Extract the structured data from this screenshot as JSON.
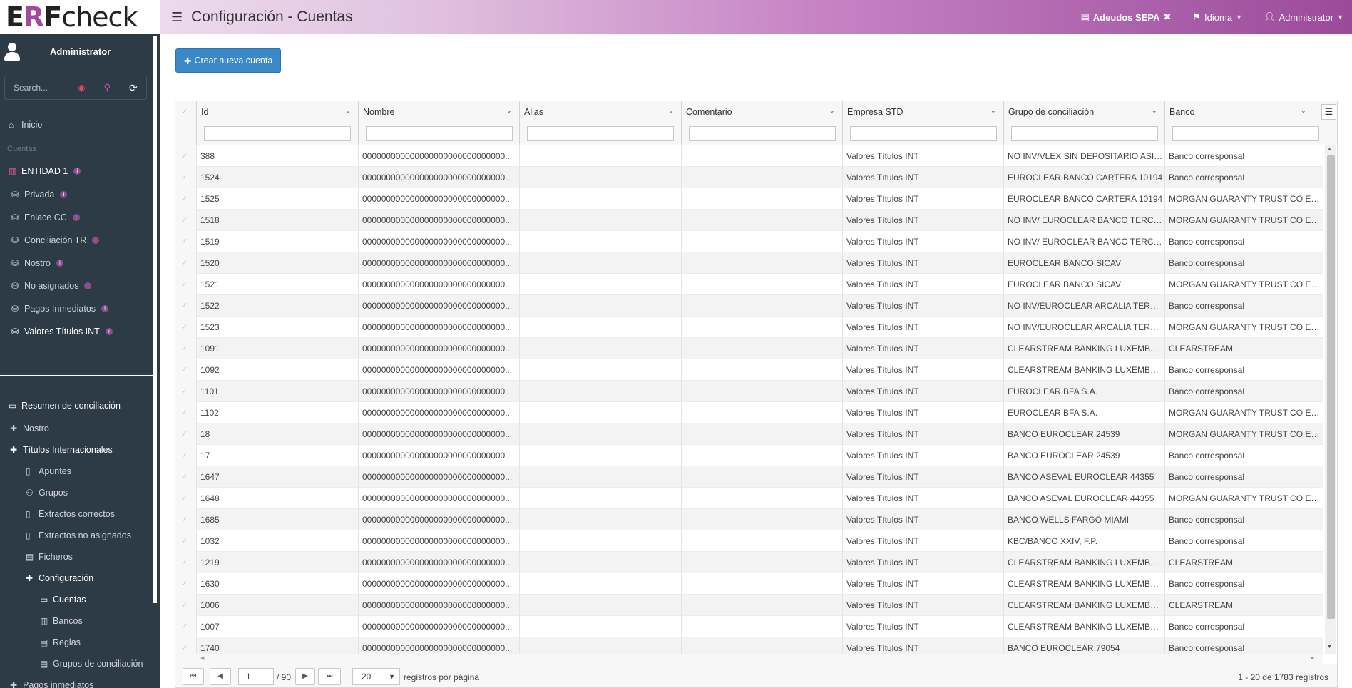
{
  "topbar": {
    "logo_prefix": "E",
    "logo_r": "R",
    "logo_f": "F",
    "logo_suffix": "check",
    "title": "Configuración - Cuentas",
    "sepa": "Adeudos SEPA",
    "idioma": "Idioma",
    "admin": "Administrator"
  },
  "sidebar": {
    "user": "Administrator",
    "search_placeholder": "Search...",
    "inicio": "Inicio",
    "section_cuentas": "Cuentas",
    "entidad": "ENTIDAD 1",
    "entities": [
      "Privada",
      "Enlace CC",
      "Conciliación TR",
      "Nostro",
      "No asignados",
      "Pagos Inmediatos",
      "Valores Títulos INT"
    ],
    "resumen": "Resumen de conciliación",
    "nostro": "Nostro",
    "titulos": "Títulos Internacionales",
    "sub": [
      "Apuntes",
      "Grupos",
      "Extractos correctos",
      "Extractos no asignados",
      "Ficheros"
    ],
    "configuracion": "Configuración",
    "config_sub": [
      "Cuentas",
      "Bancos",
      "Reglas",
      "Grupos de conciliación"
    ],
    "pagos": "Pagos inmediatos"
  },
  "main": {
    "create_button": "Crear nueva cuenta",
    "columns": [
      "Id",
      "Nombre",
      "Alias",
      "Comentario",
      "Empresa STD",
      "Grupo de conciliación",
      "Banco"
    ],
    "rows": [
      [
        "388",
        "000000000000000000000000000000...",
        "",
        "",
        "Valores Títulos INT",
        "NO INV/VLEX SIN DEPOSITARIO ASIGN...",
        "Banco corresponsal"
      ],
      [
        "1524",
        "000000000000000000000000000000...",
        "",
        "",
        "Valores Títulos INT",
        "EUROCLEAR BANCO CARTERA 10194",
        "Banco corresponsal"
      ],
      [
        "1525",
        "000000000000000000000000000000...",
        "",
        "",
        "Valores Títulos INT",
        "EUROCLEAR BANCO CARTERA 10194",
        "MORGAN GUARANTY TRUST CO EURO..."
      ],
      [
        "1518",
        "000000000000000000000000000000...",
        "",
        "",
        "Valores Títulos INT",
        "NO INV/ EUROCLEAR BANCO TERCEROS",
        "MORGAN GUARANTY TRUST CO EURO..."
      ],
      [
        "1519",
        "000000000000000000000000000000...",
        "",
        "",
        "Valores Títulos INT",
        "NO INV/ EUROCLEAR BANCO TERCEROS",
        "Banco corresponsal"
      ],
      [
        "1520",
        "000000000000000000000000000000...",
        "",
        "",
        "Valores Títulos INT",
        "EUROCLEAR BANCO SICAV",
        "Banco corresponsal"
      ],
      [
        "1521",
        "000000000000000000000000000000...",
        "",
        "",
        "Valores Títulos INT",
        "EUROCLEAR BANCO SICAV",
        "MORGAN GUARANTY TRUST CO EURO..."
      ],
      [
        "1522",
        "000000000000000000000000000000...",
        "",
        "",
        "Valores Títulos INT",
        "NO INV/EUROCLEAR ARCALIA TERC/SI...",
        "Banco corresponsal"
      ],
      [
        "1523",
        "000000000000000000000000000000...",
        "",
        "",
        "Valores Títulos INT",
        "NO INV/EUROCLEAR ARCALIA TERC/SI...",
        "MORGAN GUARANTY TRUST CO EURO..."
      ],
      [
        "1091",
        "000000000000000000000000000000...",
        "",
        "",
        "Valores Títulos INT",
        "CLEARSTREAM BANKING LUXEMBOUR...",
        "CLEARSTREAM"
      ],
      [
        "1092",
        "000000000000000000000000000000...",
        "",
        "",
        "Valores Títulos INT",
        "CLEARSTREAM BANKING LUXEMBOUR...",
        "Banco corresponsal"
      ],
      [
        "1101",
        "000000000000000000000000000000...",
        "",
        "",
        "Valores Títulos INT",
        "EUROCLEAR BFA S.A.",
        "Banco corresponsal"
      ],
      [
        "1102",
        "000000000000000000000000000000...",
        "",
        "",
        "Valores Títulos INT",
        "EUROCLEAR BFA S.A.",
        "MORGAN GUARANTY TRUST CO EURO..."
      ],
      [
        "18",
        "000000000000000000000000000000...",
        "",
        "",
        "Valores Títulos INT",
        "BANCO EUROCLEAR 24539",
        "MORGAN GUARANTY TRUST CO EURO..."
      ],
      [
        "17",
        "000000000000000000000000000000...",
        "",
        "",
        "Valores Títulos INT",
        "BANCO EUROCLEAR 24539",
        "Banco corresponsal"
      ],
      [
        "1647",
        "000000000000000000000000000000...",
        "",
        "",
        "Valores Títulos INT",
        "BANCO ASEVAL EUROCLEAR 44355",
        "Banco corresponsal"
      ],
      [
        "1648",
        "000000000000000000000000000000...",
        "",
        "",
        "Valores Títulos INT",
        "BANCO ASEVAL EUROCLEAR 44355",
        "MORGAN GUARANTY TRUST CO EURO..."
      ],
      [
        "1685",
        "000000000000000000000000000000...",
        "",
        "",
        "Valores Títulos INT",
        "BANCO WELLS FARGO MIAMI",
        "Banco corresponsal"
      ],
      [
        "1032",
        "000000000000000000000000000000...",
        "",
        "",
        "Valores Títulos INT",
        "KBC/BANCO XXIV, F.P.",
        "Banco corresponsal"
      ],
      [
        "1219",
        "000000000000000000000000000000...",
        "",
        "",
        "Valores Títulos INT",
        "CLEARSTREAM BANKING LUXEMBOUR...",
        "CLEARSTREAM"
      ],
      [
        "1630",
        "000000000000000000000000000000...",
        "",
        "",
        "Valores Títulos INT",
        "CLEARSTREAM BANKING LUXEMBOUR...",
        "Banco corresponsal"
      ],
      [
        "1006",
        "000000000000000000000000000000...",
        "",
        "",
        "Valores Títulos INT",
        "CLEARSTREAM BANKING LUXEMBOURG",
        "CLEARSTREAM"
      ],
      [
        "1007",
        "000000000000000000000000000000...",
        "",
        "",
        "Valores Títulos INT",
        "CLEARSTREAM BANKING LUXEMBOURG",
        "Banco corresponsal"
      ],
      [
        "1740",
        "000000000000000000000000000000...",
        "",
        "",
        "Valores Títulos INT",
        "BANCO EUROCLEAR 79054",
        "Banco corresponsal"
      ]
    ],
    "pager": {
      "current_page": "1",
      "total_pages": "/ 90",
      "page_size": "20",
      "per_page_label": "registros por página",
      "count": "1 - 20 de 1783 registros"
    }
  },
  "colors": {
    "accent": "#3a88c8",
    "sidebar_bg": "#2d3b47",
    "brand": "#9b4a9a"
  }
}
